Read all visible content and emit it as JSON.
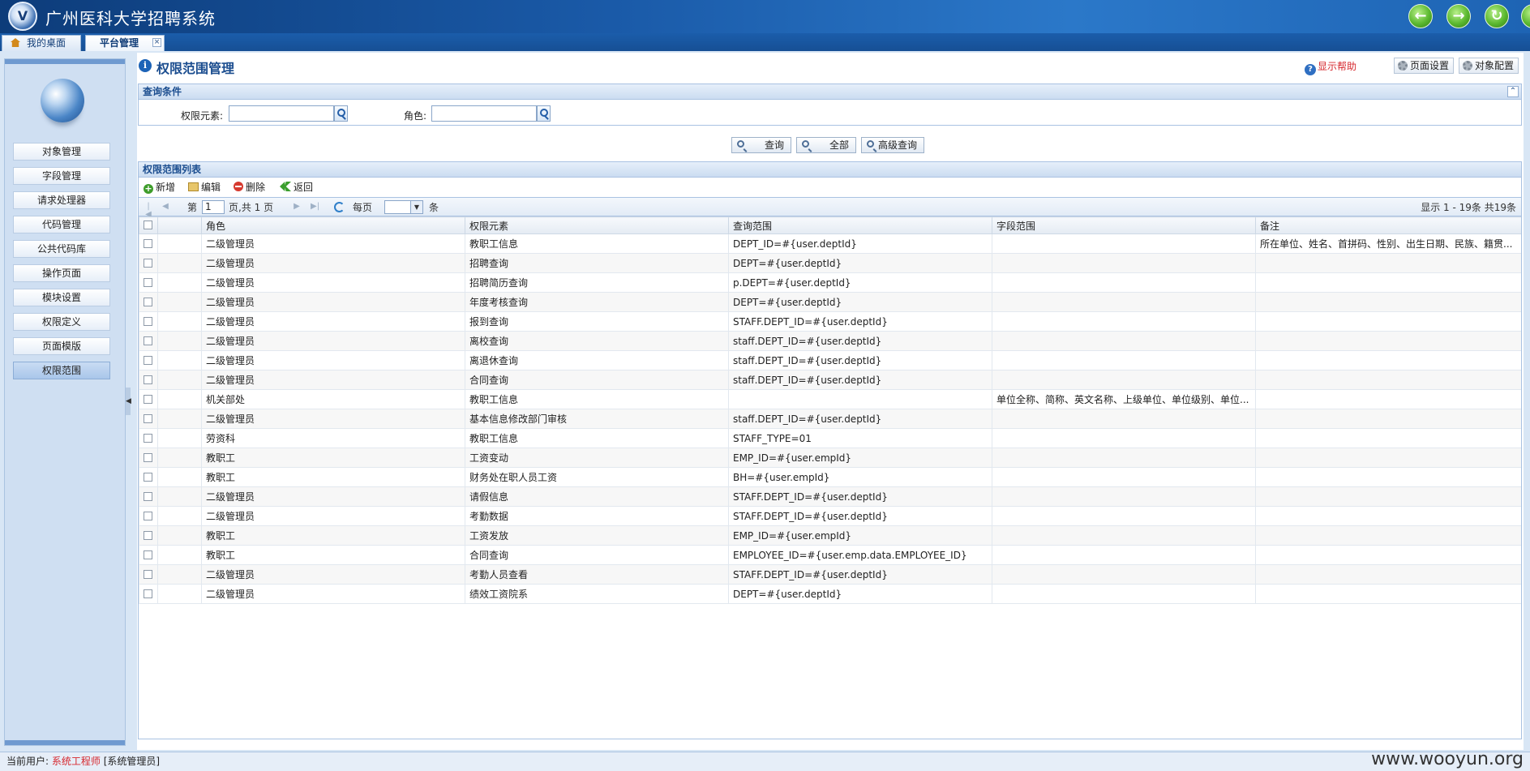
{
  "app": {
    "logo_text": "V",
    "title": "广州医科大学招聘系统"
  },
  "tabs": [
    {
      "label": "我的桌面",
      "icon": "home-icon"
    },
    {
      "label": "平台管理",
      "close": "×"
    }
  ],
  "sidebar": {
    "items": [
      {
        "label": "对象管理"
      },
      {
        "label": "字段管理"
      },
      {
        "label": "请求处理器"
      },
      {
        "label": "代码管理"
      },
      {
        "label": "公共代码库"
      },
      {
        "label": "操作页面"
      },
      {
        "label": "模块设置"
      },
      {
        "label": "权限定义"
      },
      {
        "label": "页面模版"
      },
      {
        "label": "权限范围",
        "selected": true
      }
    ],
    "collapse_glyph": "◀"
  },
  "page": {
    "title": "权限范围管理",
    "help": "显示帮助",
    "page_settings": "页面设置",
    "object_config": "对象配置"
  },
  "query": {
    "title": "查询条件",
    "collapse_glyph": "⌃",
    "element_label": "权限元素:",
    "role_label": "角色:",
    "buttons": {
      "query": "查询",
      "all": "全部",
      "advanced": "高级查询"
    }
  },
  "list": {
    "title": "权限范围列表",
    "toolbar": {
      "add": "新增",
      "edit": "编辑",
      "delete": "删除",
      "back": "返回"
    },
    "pager": {
      "page_prefix": "第",
      "page_value": "1",
      "page_suffix": "页,共 1 页",
      "per_page": "每页",
      "per_page_unit": "条",
      "summary": "显示 1 - 19条 共19条"
    },
    "columns": [
      "角色",
      "权限元素",
      "查询范围",
      "字段范围",
      "备注"
    ],
    "rows": [
      [
        "二级管理员",
        "教职工信息",
        "DEPT_ID=#{user.deptId}",
        "",
        "所在单位、姓名、首拼码、性别、出生日期、民族、籍贯..."
      ],
      [
        "二级管理员",
        "招聘查询",
        "DEPT=#{user.deptId}",
        "",
        ""
      ],
      [
        "二级管理员",
        "招聘简历查询",
        "p.DEPT=#{user.deptId}",
        "",
        ""
      ],
      [
        "二级管理员",
        "年度考核查询",
        "DEPT=#{user.deptId}",
        "",
        ""
      ],
      [
        "二级管理员",
        "报到查询",
        "STAFF.DEPT_ID=#{user.deptId}",
        "",
        ""
      ],
      [
        "二级管理员",
        "离校查询",
        "staff.DEPT_ID=#{user.deptId}",
        "",
        ""
      ],
      [
        "二级管理员",
        "离退休查询",
        "staff.DEPT_ID=#{user.deptId}",
        "",
        ""
      ],
      [
        "二级管理员",
        "合同查询",
        "staff.DEPT_ID=#{user.deptId}",
        "",
        ""
      ],
      [
        "机关部处",
        "教职工信息",
        "",
        "单位全称、简称、英文名称、上级单位、单位级别、单位...",
        ""
      ],
      [
        "二级管理员",
        "基本信息修改部门审核",
        "staff.DEPT_ID=#{user.deptId}",
        "",
        ""
      ],
      [
        "劳资科",
        "教职工信息",
        "STAFF_TYPE=01",
        "",
        ""
      ],
      [
        "教职工",
        "工资变动",
        "EMP_ID=#{user.empId}",
        "",
        ""
      ],
      [
        "教职工",
        "财务处在职人员工资",
        "BH=#{user.empId}",
        "",
        ""
      ],
      [
        "二级管理员",
        "请假信息",
        "STAFF.DEPT_ID=#{user.deptId}",
        "",
        ""
      ],
      [
        "二级管理员",
        "考勤数据",
        "STAFF.DEPT_ID=#{user.deptId}",
        "",
        ""
      ],
      [
        "教职工",
        "工资发放",
        "EMP_ID=#{user.empId}",
        "",
        ""
      ],
      [
        "教职工",
        "合同查询",
        "EMPLOYEE_ID=#{user.emp.data.EMPLOYEE_ID}",
        "",
        ""
      ],
      [
        "二级管理员",
        "考勤人员查看",
        "STAFF.DEPT_ID=#{user.deptId}",
        "",
        ""
      ],
      [
        "二级管理员",
        "绩效工资院系",
        "DEPT=#{user.deptId}",
        "",
        ""
      ]
    ]
  },
  "footer": {
    "prefix": "当前用户:",
    "user": "系统工程师",
    "role": "[系统管理员]",
    "watermark": "www.wooyun.org"
  }
}
